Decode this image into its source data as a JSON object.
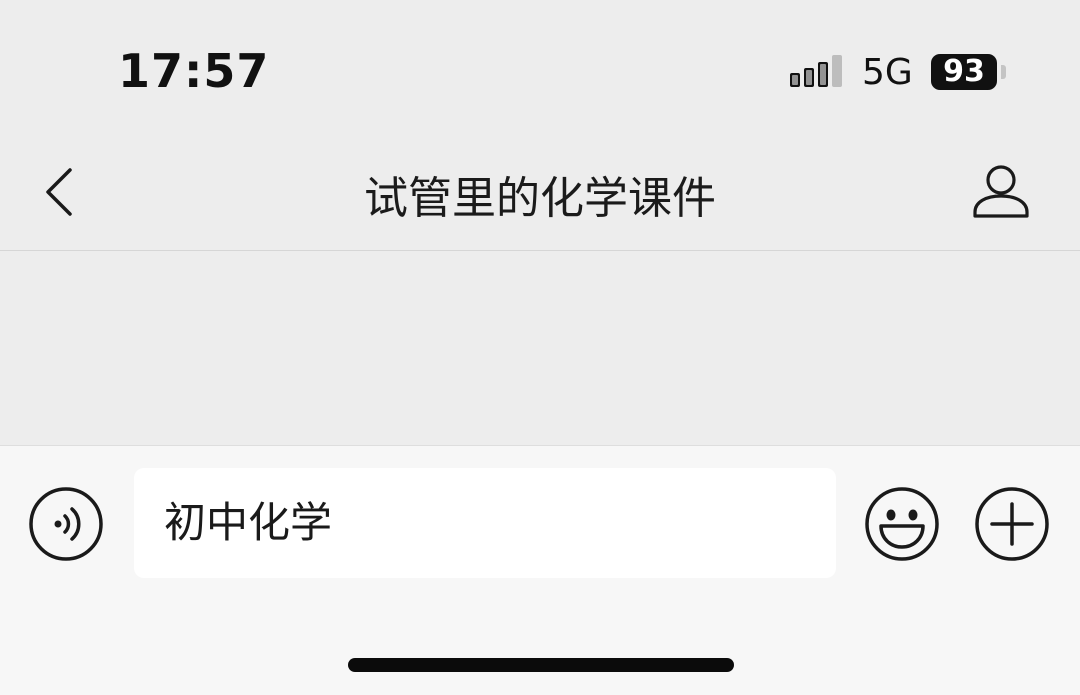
{
  "status_bar": {
    "time": "17:57",
    "network": "5G",
    "battery": "93"
  },
  "nav": {
    "title": "试管里的化学课件",
    "back_icon": "chevron-left-icon",
    "profile_icon": "person-icon"
  },
  "input_bar": {
    "value": "初中化学",
    "voice_icon": "voice-icon",
    "emoji_icon": "emoji-icon",
    "plus_icon": "plus-icon"
  }
}
